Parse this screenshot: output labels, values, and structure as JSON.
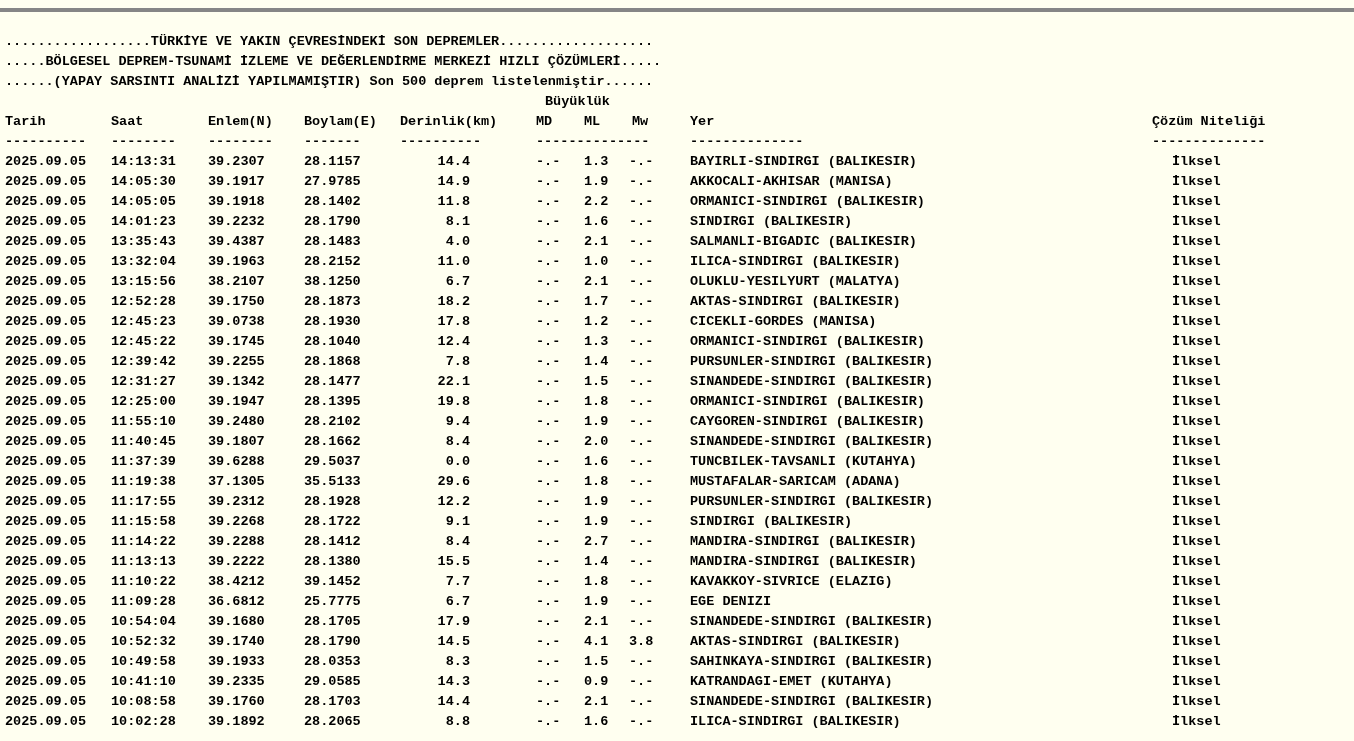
{
  "titles": [
    "..................TÜRKİYE VE YAKIN ÇEVRESİNDEKİ SON DEPREMLER...................",
    ".....BÖLGESEL DEPREM-TSUNAMİ İZLEME VE DEĞERLENDİRME MERKEZİ HIZLI ÇÖZÜMLERİ.....",
    "......(YAPAY SARSINTI ANALİZİ YAPILMAMIŞTIR) Son 500 deprem listelenmiştir......"
  ],
  "magnitude_group": "Büyüklük",
  "columns": [
    "Tarih",
    "Saat",
    "Enlem(N)",
    "Boylam(E)",
    "Derinlik(km)",
    "MD",
    "ML",
    "Mw",
    "Yer",
    "Çözüm Niteliği"
  ],
  "separators": [
    "----------",
    "--------",
    "--------",
    "-------",
    "----------",
    "--------------",
    "--------------",
    "--------------"
  ],
  "rows": [
    [
      "2025.09.05",
      "14:13:31",
      "39.2307",
      "28.1157",
      "14.4",
      "-.-",
      "1.3",
      "-.-",
      "BAYIRLI-SINDIRGI (BALIKESIR)",
      "İlksel"
    ],
    [
      "2025.09.05",
      "14:05:30",
      "39.1917",
      "27.9785",
      "14.9",
      "-.-",
      "1.9",
      "-.-",
      "AKKOCALI-AKHISAR (MANISA)",
      "İlksel"
    ],
    [
      "2025.09.05",
      "14:05:05",
      "39.1918",
      "28.1402",
      "11.8",
      "-.-",
      "2.2",
      "-.-",
      "ORMANICI-SINDIRGI (BALIKESIR)",
      "İlksel"
    ],
    [
      "2025.09.05",
      "14:01:23",
      "39.2232",
      "28.1790",
      "8.1",
      "-.-",
      "1.6",
      "-.-",
      "SINDIRGI (BALIKESIR)",
      "İlksel"
    ],
    [
      "2025.09.05",
      "13:35:43",
      "39.4387",
      "28.1483",
      "4.0",
      "-.-",
      "2.1",
      "-.-",
      "SALMANLI-BIGADIC (BALIKESIR)",
      "İlksel"
    ],
    [
      "2025.09.05",
      "13:32:04",
      "39.1963",
      "28.2152",
      "11.0",
      "-.-",
      "1.0",
      "-.-",
      "ILICA-SINDIRGI (BALIKESIR)",
      "İlksel"
    ],
    [
      "2025.09.05",
      "13:15:56",
      "38.2107",
      "38.1250",
      "6.7",
      "-.-",
      "2.1",
      "-.-",
      "OLUKLU-YESILYURT (MALATYA)",
      "İlksel"
    ],
    [
      "2025.09.05",
      "12:52:28",
      "39.1750",
      "28.1873",
      "18.2",
      "-.-",
      "1.7",
      "-.-",
      "AKTAS-SINDIRGI (BALIKESIR)",
      "İlksel"
    ],
    [
      "2025.09.05",
      "12:45:23",
      "39.0738",
      "28.1930",
      "17.8",
      "-.-",
      "1.2",
      "-.-",
      "CICEKLI-GORDES (MANISA)",
      "İlksel"
    ],
    [
      "2025.09.05",
      "12:45:22",
      "39.1745",
      "28.1040",
      "12.4",
      "-.-",
      "1.3",
      "-.-",
      "ORMANICI-SINDIRGI (BALIKESIR)",
      "İlksel"
    ],
    [
      "2025.09.05",
      "12:39:42",
      "39.2255",
      "28.1868",
      "7.8",
      "-.-",
      "1.4",
      "-.-",
      "PURSUNLER-SINDIRGI (BALIKESIR)",
      "İlksel"
    ],
    [
      "2025.09.05",
      "12:31:27",
      "39.1342",
      "28.1477",
      "22.1",
      "-.-",
      "1.5",
      "-.-",
      "SINANDEDE-SINDIRGI (BALIKESIR)",
      "İlksel"
    ],
    [
      "2025.09.05",
      "12:25:00",
      "39.1947",
      "28.1395",
      "19.8",
      "-.-",
      "1.8",
      "-.-",
      "ORMANICI-SINDIRGI (BALIKESIR)",
      "İlksel"
    ],
    [
      "2025.09.05",
      "11:55:10",
      "39.2480",
      "28.2102",
      "9.4",
      "-.-",
      "1.9",
      "-.-",
      "CAYGOREN-SINDIRGI (BALIKESIR)",
      "İlksel"
    ],
    [
      "2025.09.05",
      "11:40:45",
      "39.1807",
      "28.1662",
      "8.4",
      "-.-",
      "2.0",
      "-.-",
      "SINANDEDE-SINDIRGI (BALIKESIR)",
      "İlksel"
    ],
    [
      "2025.09.05",
      "11:37:39",
      "39.6288",
      "29.5037",
      "0.0",
      "-.-",
      "1.6",
      "-.-",
      "TUNCBILEK-TAVSANLI (KUTAHYA)",
      "İlksel"
    ],
    [
      "2025.09.05",
      "11:19:38",
      "37.1305",
      "35.5133",
      "29.6",
      "-.-",
      "1.8",
      "-.-",
      "MUSTAFALAR-SARICAM (ADANA)",
      "İlksel"
    ],
    [
      "2025.09.05",
      "11:17:55",
      "39.2312",
      "28.1928",
      "12.2",
      "-.-",
      "1.9",
      "-.-",
      "PURSUNLER-SINDIRGI (BALIKESIR)",
      "İlksel"
    ],
    [
      "2025.09.05",
      "11:15:58",
      "39.2268",
      "28.1722",
      "9.1",
      "-.-",
      "1.9",
      "-.-",
      "SINDIRGI (BALIKESIR)",
      "İlksel"
    ],
    [
      "2025.09.05",
      "11:14:22",
      "39.2288",
      "28.1412",
      "8.4",
      "-.-",
      "2.7",
      "-.-",
      "MANDIRA-SINDIRGI (BALIKESIR)",
      "İlksel"
    ],
    [
      "2025.09.05",
      "11:13:13",
      "39.2222",
      "28.1380",
      "15.5",
      "-.-",
      "1.4",
      "-.-",
      "MANDIRA-SINDIRGI (BALIKESIR)",
      "İlksel"
    ],
    [
      "2025.09.05",
      "11:10:22",
      "38.4212",
      "39.1452",
      "7.7",
      "-.-",
      "1.8",
      "-.-",
      "KAVAKKOY-SIVRICE (ELAZIG)",
      "İlksel"
    ],
    [
      "2025.09.05",
      "11:09:28",
      "36.6812",
      "25.7775",
      "6.7",
      "-.-",
      "1.9",
      "-.-",
      "EGE DENIZI",
      "İlksel"
    ],
    [
      "2025.09.05",
      "10:54:04",
      "39.1680",
      "28.1705",
      "17.9",
      "-.-",
      "2.1",
      "-.-",
      "SINANDEDE-SINDIRGI (BALIKESIR)",
      "İlksel"
    ],
    [
      "2025.09.05",
      "10:52:32",
      "39.1740",
      "28.1790",
      "14.5",
      "-.-",
      "4.1",
      "3.8",
      "AKTAS-SINDIRGI (BALIKESIR)",
      "İlksel"
    ],
    [
      "2025.09.05",
      "10:49:58",
      "39.1933",
      "28.0353",
      "8.3",
      "-.-",
      "1.5",
      "-.-",
      "SAHINKAYA-SINDIRGI (BALIKESIR)",
      "İlksel"
    ],
    [
      "2025.09.05",
      "10:41:10",
      "39.2335",
      "29.0585",
      "14.3",
      "-.-",
      "0.9",
      "-.-",
      "KATRANDAGI-EMET (KUTAHYA)",
      "İlksel"
    ],
    [
      "2025.09.05",
      "10:08:58",
      "39.1760",
      "28.1703",
      "14.4",
      "-.-",
      "2.1",
      "-.-",
      "SINANDEDE-SINDIRGI (BALIKESIR)",
      "İlksel"
    ],
    [
      "2025.09.05",
      "10:02:28",
      "39.1892",
      "28.2065",
      "8.8",
      "-.-",
      "1.6",
      "-.-",
      "ILICA-SINDIRGI (BALIKESIR)",
      "İlksel"
    ]
  ]
}
